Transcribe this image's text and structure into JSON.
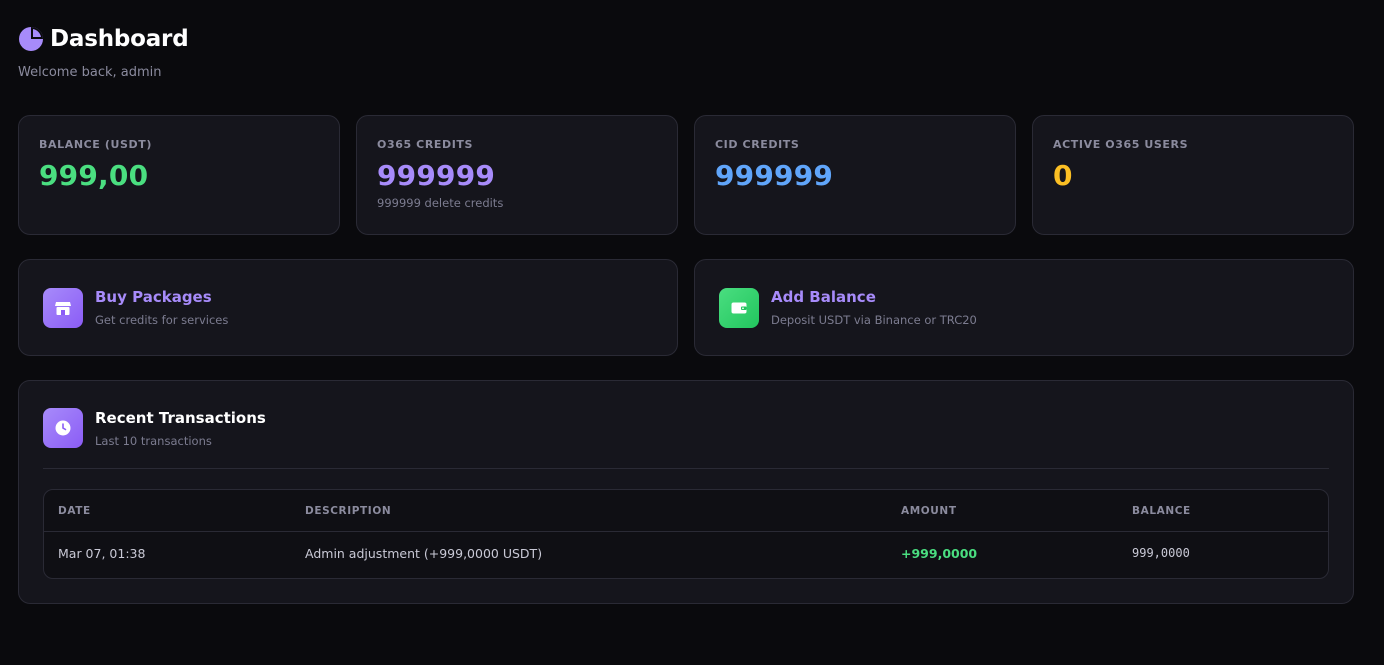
{
  "header": {
    "title": "Dashboard",
    "subtitle": "Welcome back, admin"
  },
  "stats": [
    {
      "label": "BALANCE (USDT)",
      "value": "999,00",
      "color": "#4ade80"
    },
    {
      "label": "O365 CREDITS",
      "value": "999999",
      "sub": "999999 delete credits",
      "color": "#a78bfa"
    },
    {
      "label": "CID CREDITS",
      "value": "999999",
      "color": "#60a5fa"
    },
    {
      "label": "ACTIVE O365 USERS",
      "value": "0",
      "color": "#fbbf24"
    }
  ],
  "actions": {
    "buy": {
      "title": "Buy Packages",
      "desc": "Get credits for services",
      "icon": "store-icon",
      "title_color": "#a78bfa",
      "icon_bg": "#8b5cf6"
    },
    "add": {
      "title": "Add Balance",
      "desc": "Deposit USDT via Binance or TRC20",
      "icon": "wallet-icon",
      "title_color": "#a78bfa",
      "icon_bg": "#22c55e"
    }
  },
  "transactions": {
    "title": "Recent Transactions",
    "subtitle": "Last 10 transactions",
    "icon": "clock-icon",
    "columns": [
      "DATE",
      "DESCRIPTION",
      "AMOUNT",
      "BALANCE"
    ],
    "rows": [
      {
        "date": "Mar 07, 01:38",
        "description": "Admin adjustment (+999,0000 USDT)",
        "amount": "+999,0000",
        "balance": "999,0000"
      }
    ]
  }
}
